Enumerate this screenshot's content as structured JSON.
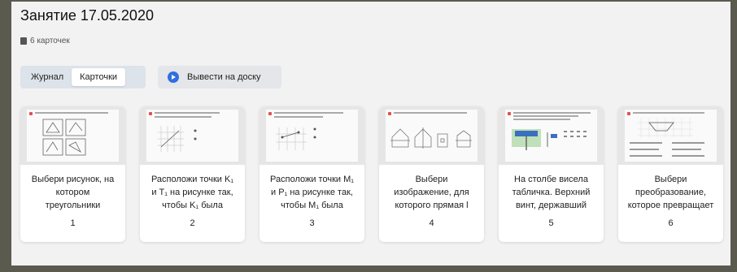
{
  "page": {
    "title": "Занятие 17.05.2020",
    "card_count": "6 карточек"
  },
  "tabs": [
    {
      "label": "Журнал"
    },
    {
      "label": "Карточки"
    }
  ],
  "board_button": {
    "label": "Вывести на доску"
  },
  "cards": [
    {
      "text_lines": [
        "Выбери рисунок, на",
        "котором",
        "треугольники"
      ],
      "number": "1"
    },
    {
      "text_lines": [
        "Расположи точки K₁",
        "и T₁ на рисунке так,",
        "чтобы K₁ была"
      ],
      "number": "2"
    },
    {
      "text_lines": [
        "Расположи точки M₁",
        "и P₁ на рисунке так,",
        "чтобы M₁ была"
      ],
      "number": "3"
    },
    {
      "text_lines": [
        "Выбери",
        "изображение, для",
        "которого прямая l"
      ],
      "number": "4"
    },
    {
      "text_lines": [
        "На столбе висела",
        "табличка. Верхний",
        "винт, державший"
      ],
      "number": "5"
    },
    {
      "text_lines": [
        "Выбери",
        "преобразование,",
        "которое превращает"
      ],
      "number": "6"
    }
  ],
  "colors": {
    "accent": "#2f6fe0",
    "background": "#f2f2f2"
  }
}
